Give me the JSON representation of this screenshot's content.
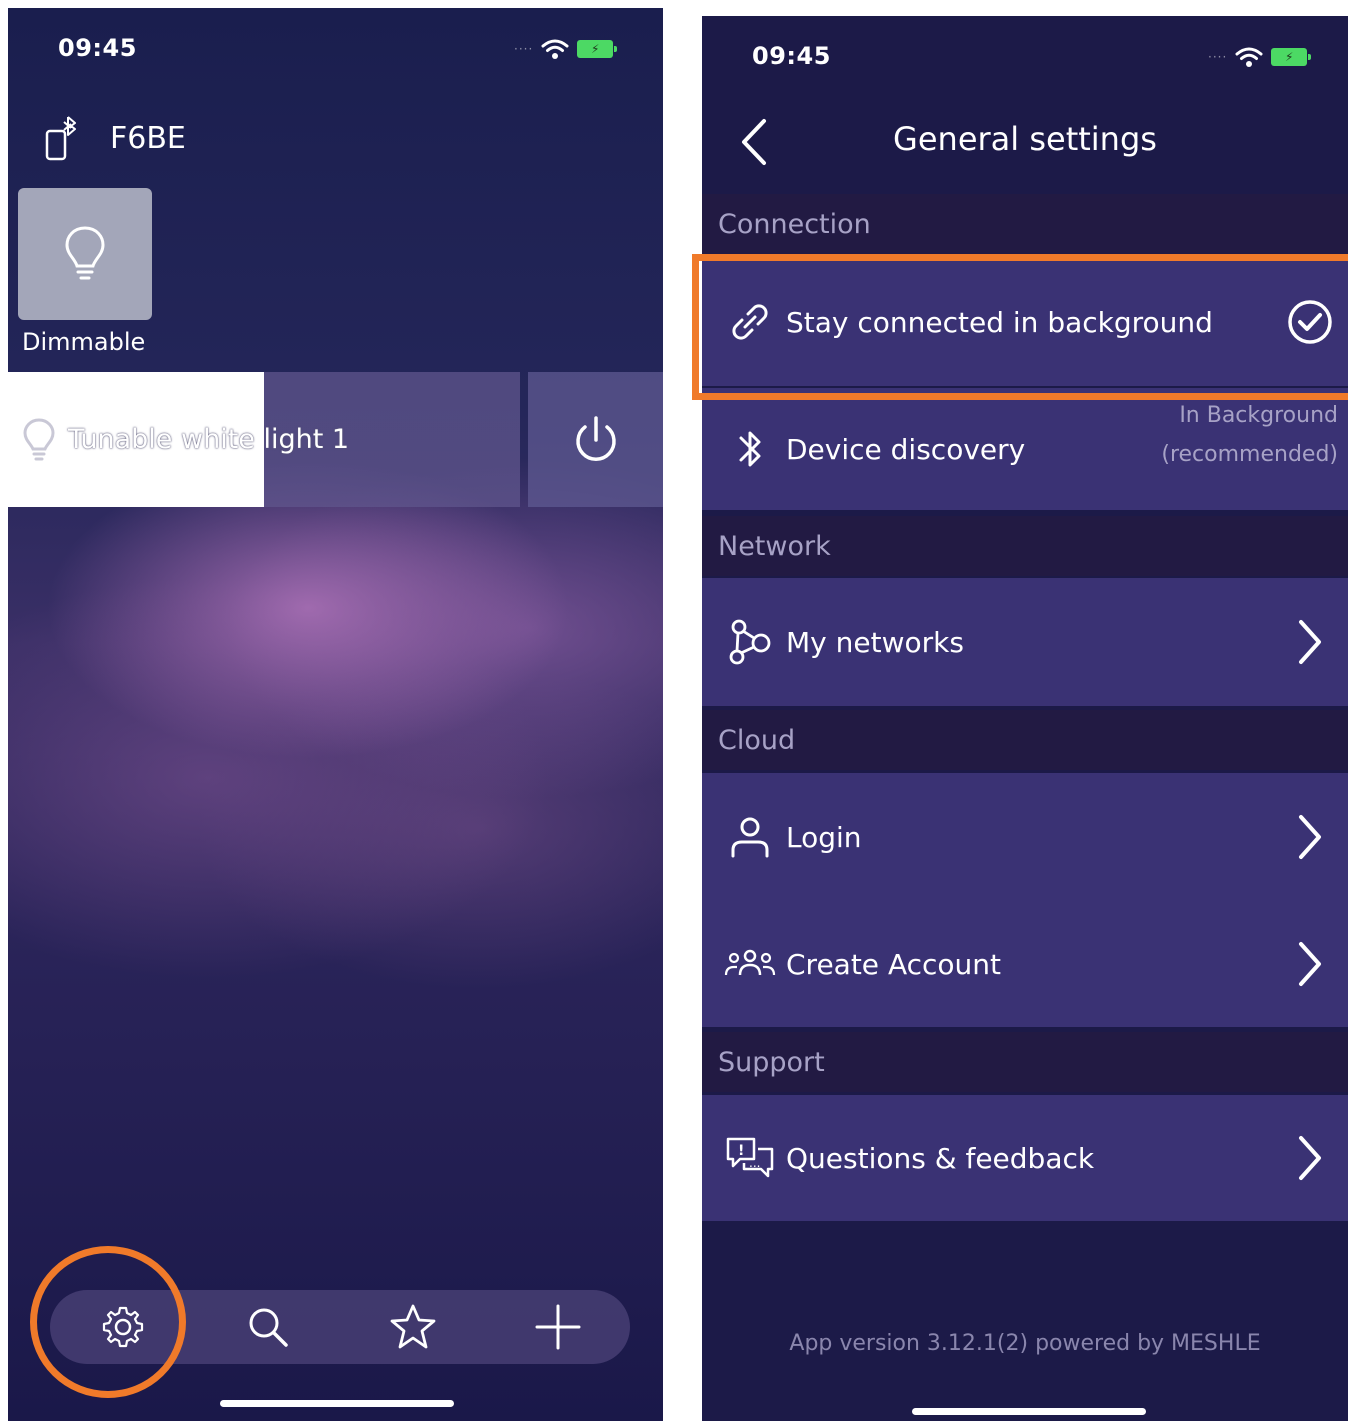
{
  "left_screen": {
    "status": {
      "time": "09:45",
      "battery_icon": "battery-charging-icon"
    },
    "device": {
      "name": "F6BE",
      "icon": "phone-bluetooth-icon"
    },
    "tile": {
      "label": "Dimmable",
      "icon": "bulb-icon"
    },
    "light": {
      "name": "Tunable white light 1",
      "icon": "bulb-icon",
      "action_icon": "power-icon"
    },
    "toolbar": {
      "items": [
        "gear-icon",
        "search-icon",
        "star-icon",
        "plus-icon"
      ]
    }
  },
  "right_screen": {
    "status": {
      "time": "09:45"
    },
    "nav": {
      "title": "General settings",
      "back_icon": "chevron-left-icon"
    },
    "sections": {
      "connection": "Connection",
      "network": "Network",
      "cloud": "Cloud",
      "support": "Support"
    },
    "rows": {
      "stay_connected": "Stay connected in background",
      "device_discovery": "Device discovery",
      "device_discovery_value_line1": "In Background",
      "device_discovery_value_line2": "(recommended)",
      "my_networks": "My networks",
      "login": "Login",
      "create_account": "Create Account",
      "questions": "Questions & feedback"
    },
    "footer": {
      "app_version": "App version 3.12.1(2) powered by MESHLE"
    }
  },
  "colors": {
    "highlight": "#f07a2a",
    "row_bg": "#3a3274",
    "section_bg": "#221a43",
    "screen_bg": "#1c1a48",
    "battery": "#4cd964"
  }
}
